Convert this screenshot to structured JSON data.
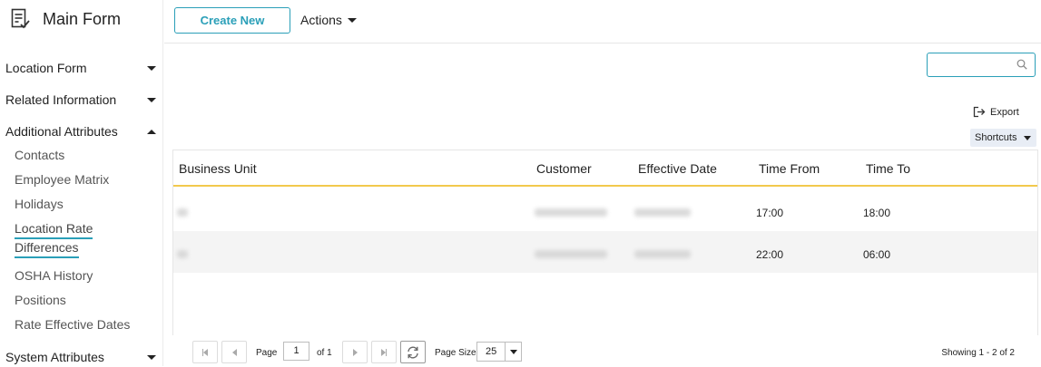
{
  "sidebar": {
    "title": "Main Form",
    "sections": [
      {
        "label": "Location Form",
        "expanded": false
      },
      {
        "label": "Related Information",
        "expanded": false
      },
      {
        "label": "Additional Attributes",
        "expanded": true
      },
      {
        "label": "System Attributes",
        "expanded": false
      }
    ],
    "subitems": [
      {
        "label": "Contacts"
      },
      {
        "label": "Employee Matrix"
      },
      {
        "label": "Holidays"
      },
      {
        "label": "Location Rate Differences",
        "line1": "Location Rate",
        "line2": "Differences",
        "active": true
      },
      {
        "label": "OSHA History"
      },
      {
        "label": "Positions"
      },
      {
        "label": "Rate Effective Dates"
      }
    ]
  },
  "toolbar": {
    "create_label": "Create New",
    "actions_label": "Actions"
  },
  "search": {
    "value": "",
    "placeholder": ""
  },
  "export_label": "Export",
  "shortcuts_label": "Shortcuts",
  "accent_color": "#2a9fb8",
  "header_underline_color": "#f2c94c",
  "grid": {
    "columns": [
      "Business Unit",
      "Customer",
      "Effective Date",
      "Time From",
      "Time To"
    ],
    "rows": [
      {
        "business_unit": "",
        "customer": "",
        "effective_date": "",
        "time_from": "17:00",
        "time_to": "18:00"
      },
      {
        "business_unit": "",
        "customer": "",
        "effective_date": "",
        "time_from": "22:00",
        "time_to": "06:00"
      }
    ]
  },
  "pager": {
    "page_label": "Page",
    "page_value": "1",
    "of_label": "of 1",
    "page_size_label": "Page Size",
    "page_size_value": "25",
    "showing": "Showing 1 - 2 of 2"
  }
}
